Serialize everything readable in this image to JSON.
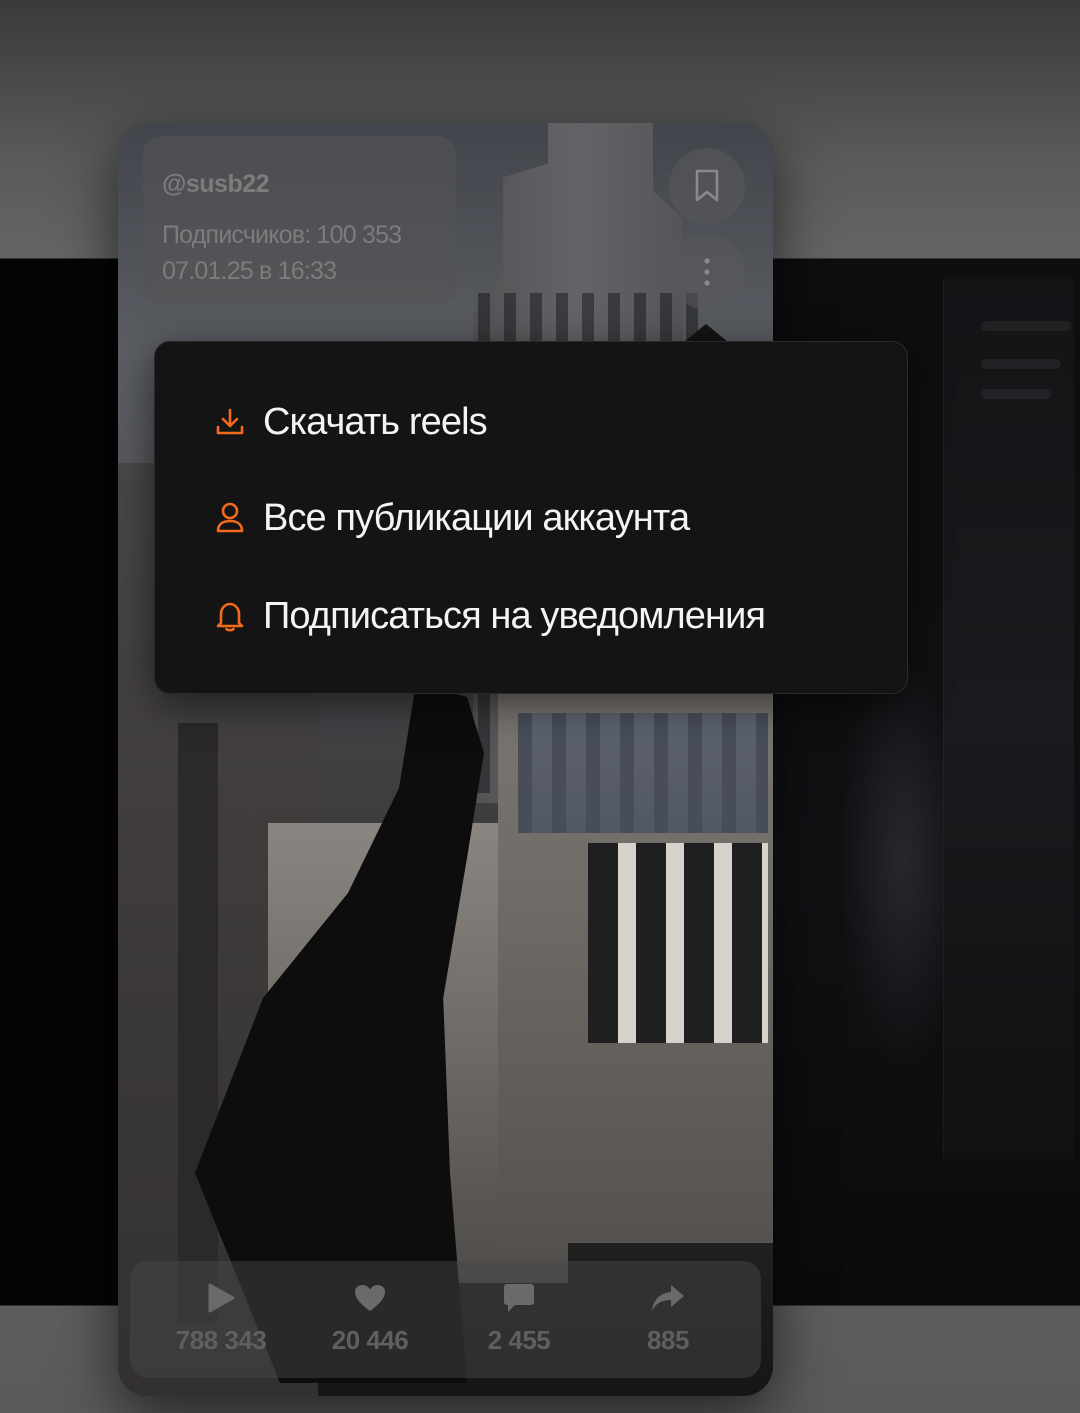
{
  "reel": {
    "handle": "@susb22",
    "subscribers": "Подписчиков: 100 353",
    "posted": "07.01.25 в 16:33"
  },
  "actions": {
    "bookmark_icon": "bookmark-icon",
    "more_icon": "more-vertical-icon"
  },
  "menu": {
    "accent_color": "#f26b1d",
    "items": [
      {
        "label": "Скачать reels",
        "icon": "download-icon"
      },
      {
        "label": "Все публикации аккаунта",
        "icon": "user-icon"
      },
      {
        "label": "Подписаться на уведомления",
        "icon": "bell-icon"
      }
    ]
  },
  "stats": [
    {
      "icon": "play-icon",
      "value": "788 343"
    },
    {
      "icon": "heart-icon",
      "value": "20 446"
    },
    {
      "icon": "comment-icon",
      "value": "2 455"
    },
    {
      "icon": "share-icon",
      "value": "885"
    }
  ]
}
